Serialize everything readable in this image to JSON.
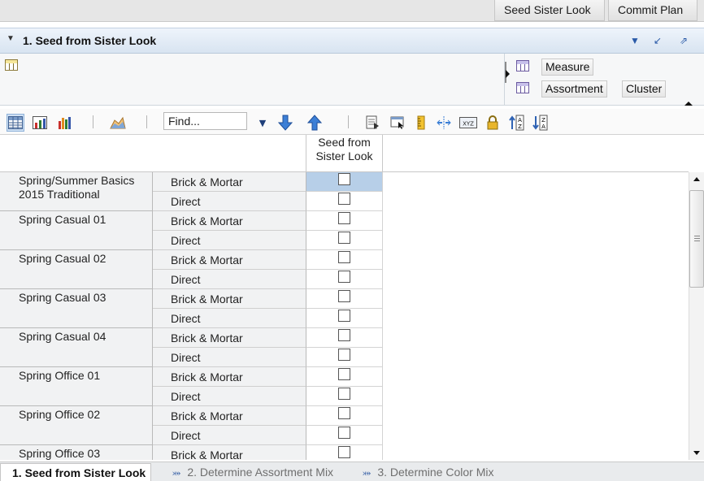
{
  "topbar": {
    "seed_sister_look": "Seed Sister Look",
    "commit_plan": "Commit Plan"
  },
  "section": {
    "title": "1. Seed from Sister Look"
  },
  "pivot": {
    "tiles": {
      "measure": "Measure",
      "assortment": "Assortment",
      "cluster": "Cluster"
    }
  },
  "toolbar": {
    "find_placeholder": "Find..."
  },
  "grid": {
    "column_header": "Seed from Sister Look",
    "looks": [
      {
        "name": "Spring/Summer Basics 2015 Traditional",
        "channels": [
          "Brick & Mortar",
          "Direct"
        ]
      },
      {
        "name": "Spring Casual 01",
        "channels": [
          "Brick & Mortar",
          "Direct"
        ]
      },
      {
        "name": "Spring Casual 02",
        "channels": [
          "Brick & Mortar",
          "Direct"
        ]
      },
      {
        "name": "Spring Casual 03",
        "channels": [
          "Brick & Mortar",
          "Direct"
        ]
      },
      {
        "name": "Spring Casual 04",
        "channels": [
          "Brick & Mortar",
          "Direct"
        ]
      },
      {
        "name": "Spring Office 01",
        "channels": [
          "Brick & Mortar",
          "Direct"
        ]
      },
      {
        "name": "Spring Office 02",
        "channels": [
          "Brick & Mortar",
          "Direct"
        ]
      },
      {
        "name": "Spring Office 03",
        "channels": [
          "Brick & Mortar"
        ]
      }
    ]
  },
  "tabs": [
    {
      "label": "1. Seed from Sister Look",
      "active": true
    },
    {
      "label": "2. Determine Assortment Mix",
      "active": false
    },
    {
      "label": "3. Determine Color Mix",
      "active": false
    }
  ]
}
